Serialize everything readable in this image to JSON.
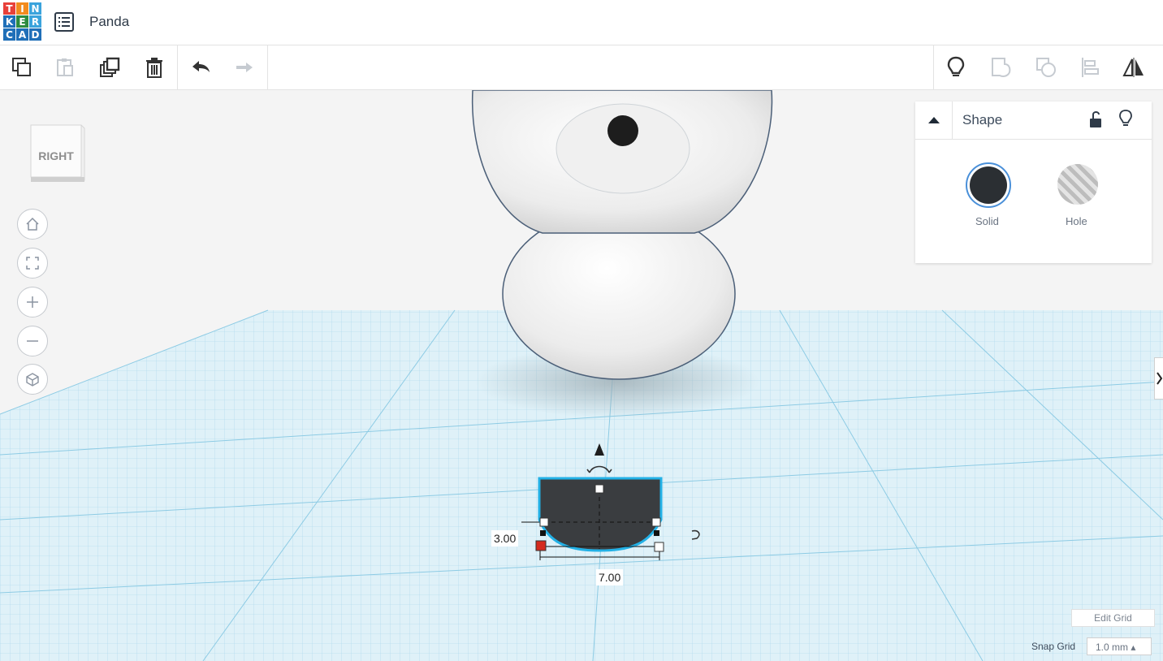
{
  "app": {
    "logo_letters": [
      "T",
      "I",
      "N",
      "K",
      "E",
      "R",
      "C",
      "A",
      "D"
    ],
    "project_title": "Panda"
  },
  "toolbar": {
    "left": [
      "copy-icon",
      "paste-icon",
      "duplicate-icon",
      "delete-icon",
      "undo-icon",
      "redo-icon"
    ],
    "right": [
      "lightbulb-icon",
      "group-icon",
      "ungroup-icon",
      "align-icon",
      "mirror-icon"
    ]
  },
  "viewcube": {
    "face_label": "RIGHT"
  },
  "nav": [
    "home-view",
    "fit-view",
    "zoom-in",
    "zoom-out",
    "ortho-view"
  ],
  "inspector": {
    "title": "Shape",
    "options": [
      {
        "label": "Solid",
        "color": "#2b2f33"
      },
      {
        "label": "Hole"
      }
    ]
  },
  "workplane": {
    "dim_height": "3.00",
    "dim_width": "7.00",
    "grid_color": "#bfe3f2",
    "selection_color": "#23b1e6"
  },
  "grid_controls": {
    "edit_grid": "Edit Grid",
    "snap_label": "Snap Grid",
    "snap_value": "1.0 mm ▴"
  }
}
